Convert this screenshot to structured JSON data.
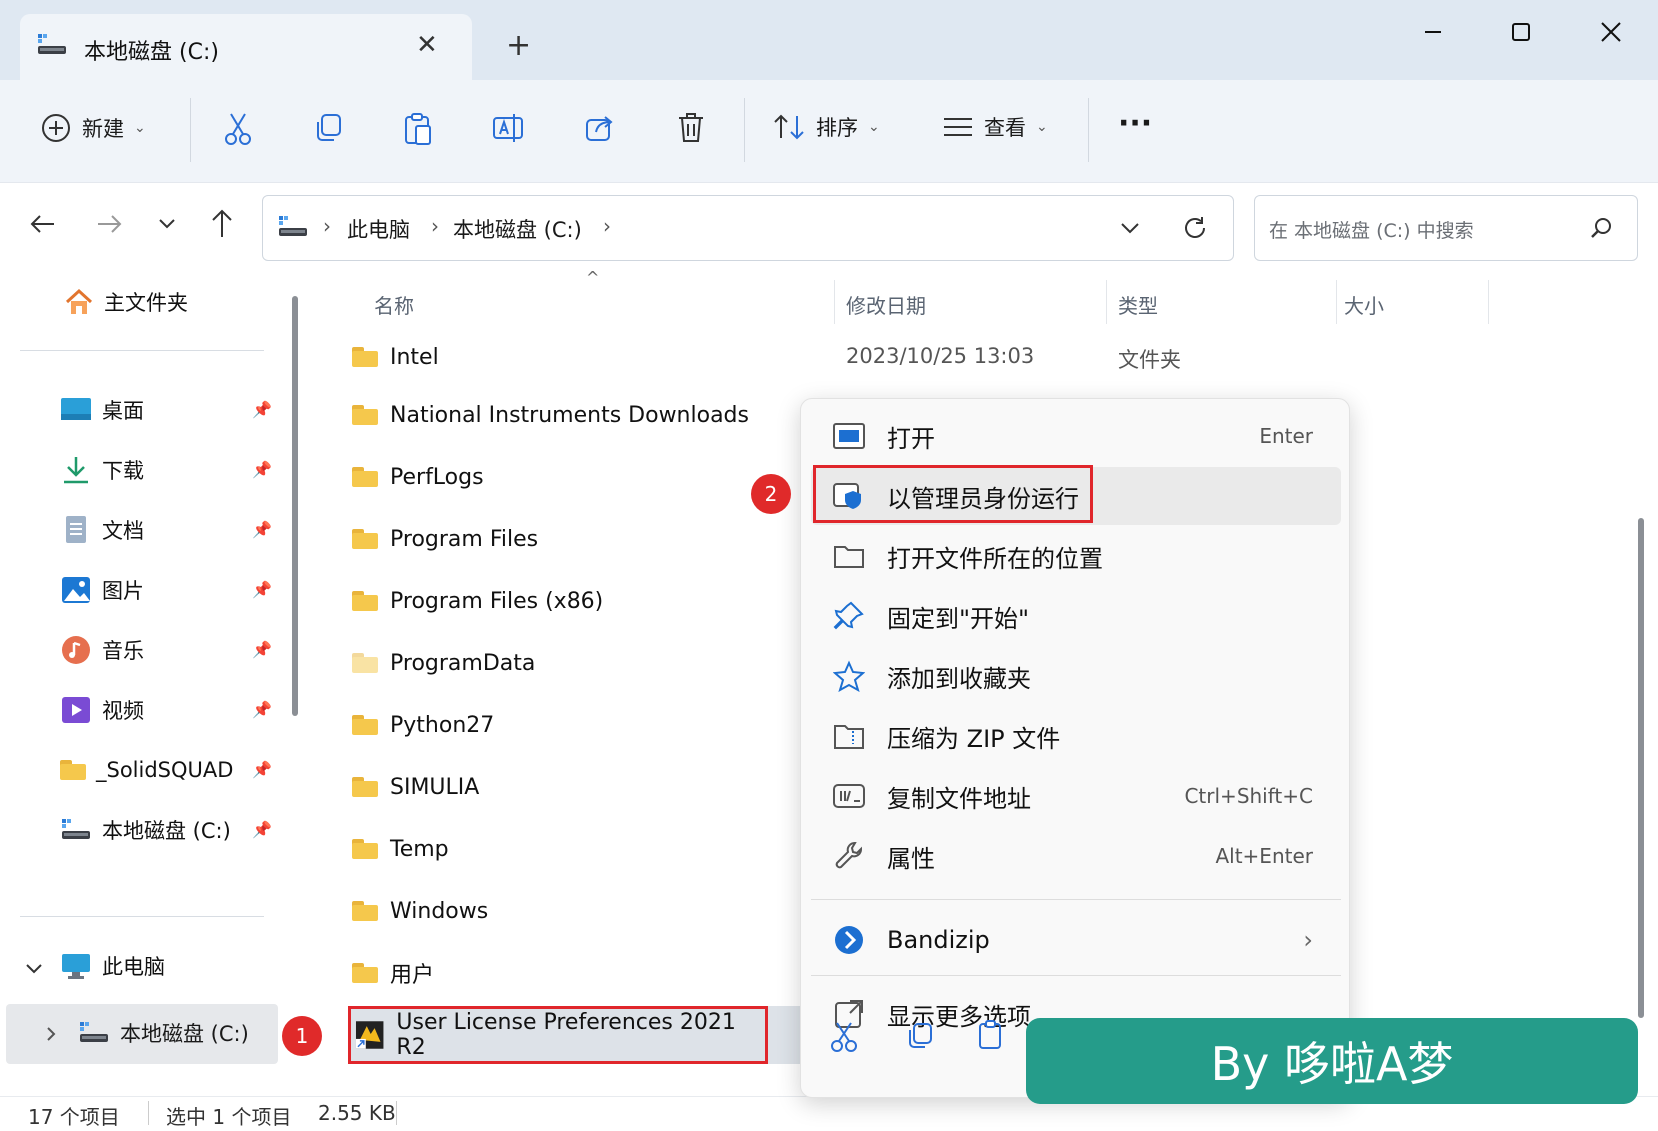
{
  "window": {
    "tab_title": "本地磁盘 (C:)",
    "tab_close": "✕",
    "new_tab": "+"
  },
  "toolbar": {
    "new_label": "新建",
    "sort_label": "排序",
    "view_label": "查看",
    "more_label": "···"
  },
  "address": {
    "crumbs": [
      "此电脑",
      "本地磁盘 (C:)"
    ],
    "search_placeholder": "在 本地磁盘 (C:) 中搜索"
  },
  "sidebar": {
    "home": "主文件夹",
    "quick": [
      {
        "label": "桌面",
        "icon": "desktop-icon"
      },
      {
        "label": "下载",
        "icon": "download-icon"
      },
      {
        "label": "文档",
        "icon": "document-icon"
      },
      {
        "label": "图片",
        "icon": "picture-icon"
      },
      {
        "label": "音乐",
        "icon": "music-icon"
      },
      {
        "label": "视频",
        "icon": "video-icon"
      },
      {
        "label": "_SolidSQUAD",
        "icon": "folder-icon"
      },
      {
        "label": "本地磁盘 (C:)",
        "icon": "drive-icon"
      }
    ],
    "this_pc": "此电脑",
    "local_disk": "本地磁盘 (C:)"
  },
  "columns": {
    "name": "名称",
    "modified": "修改日期",
    "type": "类型",
    "size": "大小"
  },
  "files": [
    {
      "name": "Intel",
      "modified": "2023/10/25 13:03",
      "type": "文件夹"
    },
    {
      "name": "National Instruments Downloads"
    },
    {
      "name": "PerfLogs"
    },
    {
      "name": "Program Files"
    },
    {
      "name": "Program Files (x86)"
    },
    {
      "name": "ProgramData"
    },
    {
      "name": "Python27"
    },
    {
      "name": "SIMULIA"
    },
    {
      "name": "Temp"
    },
    {
      "name": "Windows"
    },
    {
      "name": "用户"
    },
    {
      "name": "User License Preferences 2021 R2"
    }
  ],
  "context_menu": {
    "items": [
      {
        "label": "打开",
        "shortcut": "Enter",
        "icon": "open-icon"
      },
      {
        "label": "以管理员身份运行",
        "shortcut": "",
        "icon": "shield-icon"
      },
      {
        "label": "打开文件所在的位置",
        "shortcut": "",
        "icon": "folder-open-icon"
      },
      {
        "label": "固定到\"开始\"",
        "shortcut": "",
        "icon": "pin-icon"
      },
      {
        "label": "添加到收藏夹",
        "shortcut": "",
        "icon": "star-icon"
      },
      {
        "label": "压缩为 ZIP 文件",
        "shortcut": "",
        "icon": "zip-icon"
      },
      {
        "label": "复制文件地址",
        "shortcut": "Ctrl+Shift+C",
        "icon": "copy-path-icon"
      },
      {
        "label": "属性",
        "shortcut": "Alt+Enter",
        "icon": "wrench-icon"
      }
    ],
    "bandizip": "Bandizip",
    "more": "显示更多选项"
  },
  "annotations": {
    "badge1": "1",
    "badge2": "2"
  },
  "status": {
    "count": "17 个项目",
    "selection": "选中 1 个项目",
    "size": "2.55 KB"
  },
  "watermark": "By 哆啦A梦"
}
